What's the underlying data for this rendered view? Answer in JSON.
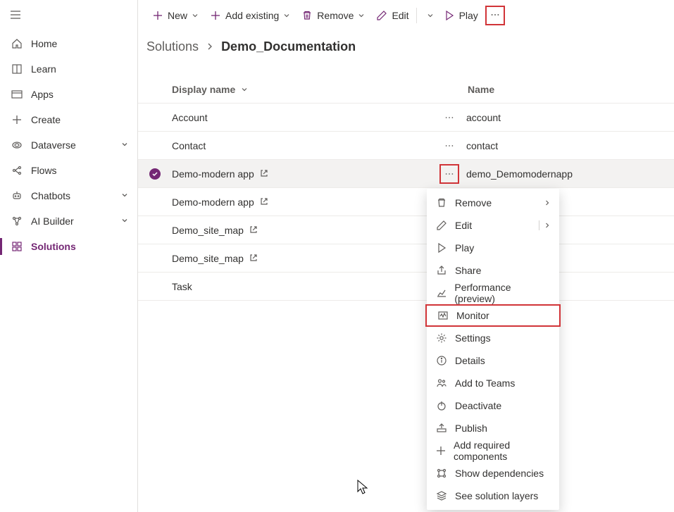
{
  "sidebar": {
    "items": [
      {
        "label": "Home"
      },
      {
        "label": "Learn"
      },
      {
        "label": "Apps"
      },
      {
        "label": "Create"
      },
      {
        "label": "Dataverse"
      },
      {
        "label": "Flows"
      },
      {
        "label": "Chatbots"
      },
      {
        "label": "AI Builder"
      },
      {
        "label": "Solutions"
      }
    ]
  },
  "commandbar": {
    "new": "New",
    "add_existing": "Add existing",
    "remove": "Remove",
    "edit": "Edit",
    "play": "Play"
  },
  "breadcrumb": {
    "parent": "Solutions",
    "current": "Demo_Documentation"
  },
  "table": {
    "headers": {
      "display_name": "Display name",
      "name": "Name"
    },
    "rows": [
      {
        "display_name": "Account",
        "name": "account",
        "open_icon": false,
        "selected": false
      },
      {
        "display_name": "Contact",
        "name": "contact",
        "open_icon": false,
        "selected": false
      },
      {
        "display_name": "Demo-modern app",
        "name": "demo_Demomodernapp",
        "open_icon": true,
        "selected": true
      },
      {
        "display_name": "Demo-modern app",
        "name": "",
        "open_icon": true,
        "selected": false
      },
      {
        "display_name": "Demo_site_map",
        "name": "",
        "open_icon": true,
        "selected": false
      },
      {
        "display_name": "Demo_site_map",
        "name": "",
        "open_icon": true,
        "selected": false
      },
      {
        "display_name": "Task",
        "name": "",
        "open_icon": false,
        "selected": false
      }
    ]
  },
  "context_menu": {
    "items": [
      {
        "label": "Remove",
        "chevron": true
      },
      {
        "label": "Edit",
        "split_chevron": true
      },
      {
        "label": "Play"
      },
      {
        "label": "Share"
      },
      {
        "label": "Performance (preview)"
      },
      {
        "label": "Monitor",
        "boxed": true
      },
      {
        "label": "Settings"
      },
      {
        "label": "Details"
      },
      {
        "label": "Add to Teams"
      },
      {
        "label": "Deactivate"
      },
      {
        "label": "Publish"
      },
      {
        "label": "Add required components"
      },
      {
        "label": "Show dependencies"
      },
      {
        "label": "See solution layers"
      }
    ]
  }
}
